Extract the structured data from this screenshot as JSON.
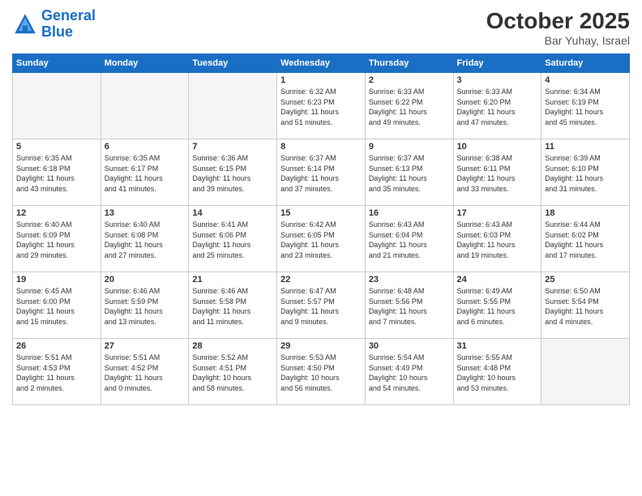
{
  "header": {
    "logo_line1": "General",
    "logo_line2": "Blue",
    "month_title": "October 2025",
    "subtitle": "Bar Yuhay, Israel"
  },
  "weekdays": [
    "Sunday",
    "Monday",
    "Tuesday",
    "Wednesday",
    "Thursday",
    "Friday",
    "Saturday"
  ],
  "weeks": [
    [
      {
        "day": "",
        "info": ""
      },
      {
        "day": "",
        "info": ""
      },
      {
        "day": "",
        "info": ""
      },
      {
        "day": "1",
        "info": "Sunrise: 6:32 AM\nSunset: 6:23 PM\nDaylight: 11 hours\nand 51 minutes."
      },
      {
        "day": "2",
        "info": "Sunrise: 6:33 AM\nSunset: 6:22 PM\nDaylight: 11 hours\nand 49 minutes."
      },
      {
        "day": "3",
        "info": "Sunrise: 6:33 AM\nSunset: 6:20 PM\nDaylight: 11 hours\nand 47 minutes."
      },
      {
        "day": "4",
        "info": "Sunrise: 6:34 AM\nSunset: 6:19 PM\nDaylight: 11 hours\nand 45 minutes."
      }
    ],
    [
      {
        "day": "5",
        "info": "Sunrise: 6:35 AM\nSunset: 6:18 PM\nDaylight: 11 hours\nand 43 minutes."
      },
      {
        "day": "6",
        "info": "Sunrise: 6:35 AM\nSunset: 6:17 PM\nDaylight: 11 hours\nand 41 minutes."
      },
      {
        "day": "7",
        "info": "Sunrise: 6:36 AM\nSunset: 6:15 PM\nDaylight: 11 hours\nand 39 minutes."
      },
      {
        "day": "8",
        "info": "Sunrise: 6:37 AM\nSunset: 6:14 PM\nDaylight: 11 hours\nand 37 minutes."
      },
      {
        "day": "9",
        "info": "Sunrise: 6:37 AM\nSunset: 6:13 PM\nDaylight: 11 hours\nand 35 minutes."
      },
      {
        "day": "10",
        "info": "Sunrise: 6:38 AM\nSunset: 6:11 PM\nDaylight: 11 hours\nand 33 minutes."
      },
      {
        "day": "11",
        "info": "Sunrise: 6:39 AM\nSunset: 6:10 PM\nDaylight: 11 hours\nand 31 minutes."
      }
    ],
    [
      {
        "day": "12",
        "info": "Sunrise: 6:40 AM\nSunset: 6:09 PM\nDaylight: 11 hours\nand 29 minutes."
      },
      {
        "day": "13",
        "info": "Sunrise: 6:40 AM\nSunset: 6:08 PM\nDaylight: 11 hours\nand 27 minutes."
      },
      {
        "day": "14",
        "info": "Sunrise: 6:41 AM\nSunset: 6:06 PM\nDaylight: 11 hours\nand 25 minutes."
      },
      {
        "day": "15",
        "info": "Sunrise: 6:42 AM\nSunset: 6:05 PM\nDaylight: 11 hours\nand 23 minutes."
      },
      {
        "day": "16",
        "info": "Sunrise: 6:43 AM\nSunset: 6:04 PM\nDaylight: 11 hours\nand 21 minutes."
      },
      {
        "day": "17",
        "info": "Sunrise: 6:43 AM\nSunset: 6:03 PM\nDaylight: 11 hours\nand 19 minutes."
      },
      {
        "day": "18",
        "info": "Sunrise: 6:44 AM\nSunset: 6:02 PM\nDaylight: 11 hours\nand 17 minutes."
      }
    ],
    [
      {
        "day": "19",
        "info": "Sunrise: 6:45 AM\nSunset: 6:00 PM\nDaylight: 11 hours\nand 15 minutes."
      },
      {
        "day": "20",
        "info": "Sunrise: 6:46 AM\nSunset: 5:59 PM\nDaylight: 11 hours\nand 13 minutes."
      },
      {
        "day": "21",
        "info": "Sunrise: 6:46 AM\nSunset: 5:58 PM\nDaylight: 11 hours\nand 11 minutes."
      },
      {
        "day": "22",
        "info": "Sunrise: 6:47 AM\nSunset: 5:57 PM\nDaylight: 11 hours\nand 9 minutes."
      },
      {
        "day": "23",
        "info": "Sunrise: 6:48 AM\nSunset: 5:56 PM\nDaylight: 11 hours\nand 7 minutes."
      },
      {
        "day": "24",
        "info": "Sunrise: 6:49 AM\nSunset: 5:55 PM\nDaylight: 11 hours\nand 6 minutes."
      },
      {
        "day": "25",
        "info": "Sunrise: 6:50 AM\nSunset: 5:54 PM\nDaylight: 11 hours\nand 4 minutes."
      }
    ],
    [
      {
        "day": "26",
        "info": "Sunrise: 5:51 AM\nSunset: 4:53 PM\nDaylight: 11 hours\nand 2 minutes."
      },
      {
        "day": "27",
        "info": "Sunrise: 5:51 AM\nSunset: 4:52 PM\nDaylight: 11 hours\nand 0 minutes."
      },
      {
        "day": "28",
        "info": "Sunrise: 5:52 AM\nSunset: 4:51 PM\nDaylight: 10 hours\nand 58 minutes."
      },
      {
        "day": "29",
        "info": "Sunrise: 5:53 AM\nSunset: 4:50 PM\nDaylight: 10 hours\nand 56 minutes."
      },
      {
        "day": "30",
        "info": "Sunrise: 5:54 AM\nSunset: 4:49 PM\nDaylight: 10 hours\nand 54 minutes."
      },
      {
        "day": "31",
        "info": "Sunrise: 5:55 AM\nSunset: 4:48 PM\nDaylight: 10 hours\nand 53 minutes."
      },
      {
        "day": "",
        "info": ""
      }
    ]
  ]
}
